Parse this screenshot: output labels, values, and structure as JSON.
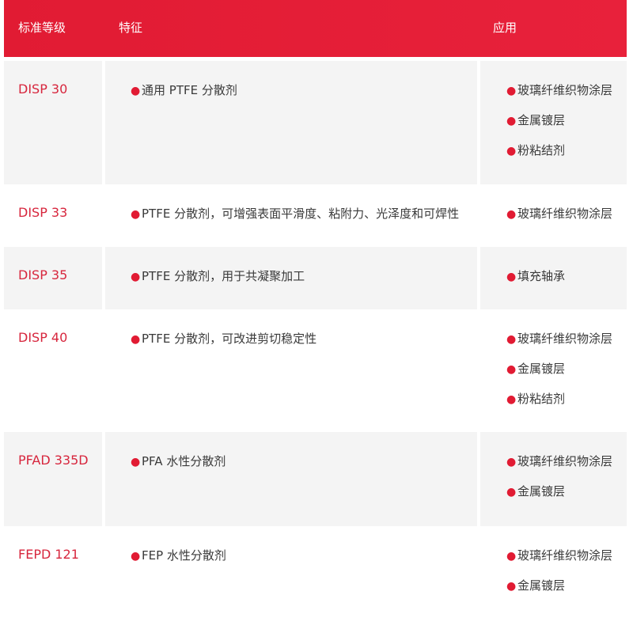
{
  "header": {
    "col1": "标准等级",
    "col2": "特征",
    "col3": "应用"
  },
  "accent_color": "#e11b33",
  "rows": [
    {
      "grade": "DISP 30",
      "feature": "通用 PTFE 分散剂",
      "applications": [
        "玻璃纤维织物涂层",
        "金属镀层",
        "粉粘结剂"
      ]
    },
    {
      "grade": "DISP 33",
      "feature": "PTFE 分散剂，可增强表面平滑度、粘附力、光泽度和可焊性",
      "applications": [
        "玻璃纤维织物涂层"
      ]
    },
    {
      "grade": "DISP 35",
      "feature": "PTFE 分散剂，用于共凝聚加工",
      "applications": [
        "填充轴承"
      ]
    },
    {
      "grade": "DISP 40",
      "feature": "PTFE 分散剂，可改进剪切稳定性",
      "applications": [
        "玻璃纤维织物涂层",
        "金属镀层",
        "粉粘结剂"
      ]
    },
    {
      "grade": "PFAD 335D",
      "feature": "PFA 水性分散剂",
      "applications": [
        "玻璃纤维织物涂层",
        "金属镀层"
      ]
    },
    {
      "grade": "FEPD 121",
      "feature": "FEP 水性分散剂",
      "applications": [
        "玻璃纤维织物涂层",
        "金属镀层"
      ]
    }
  ]
}
